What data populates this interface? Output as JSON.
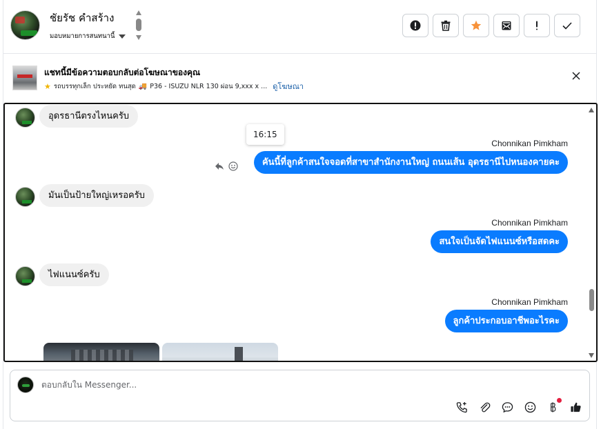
{
  "header": {
    "contact_name": "ชัยรัช คำสร้าง",
    "assign_label": "มอบหมายการสนทนานี้",
    "actions": [
      {
        "name": "report-button",
        "icon": "alert-circle-icon"
      },
      {
        "name": "delete-button",
        "icon": "trash-icon"
      },
      {
        "name": "star-button",
        "icon": "star-icon"
      },
      {
        "name": "mark-unread-button",
        "icon": "envelope-icon"
      },
      {
        "name": "spam-button",
        "icon": "exclamation-icon"
      },
      {
        "name": "done-button",
        "icon": "check-icon"
      }
    ],
    "star_color": "#f7923a"
  },
  "ad": {
    "title": "แชทนี้มีข้อความตอบกลับต่อโฆษณาของคุณ",
    "description": "รถบรรทุกเล็ก ประหยัด ทนสุด",
    "description2": "P36 - ISUZU NLR 130 ผ่อน 9,xxx x ...",
    "link": "ดูโฆษณา"
  },
  "conversation": {
    "tooltip_time": "16:15",
    "messages": [
      {
        "dir": "in",
        "text": "อุดรธานีตรงไหนครับ"
      },
      {
        "dir": "out",
        "sender": "Chonnikan Pimkham",
        "text": "คันนี้ที่ลูกค้าสนใจจอดที่สาขาสำนักงานใหญ่ ถนนเส้น อุดรธานีไปหนองคายคะ"
      },
      {
        "dir": "in",
        "text": "มันเป็นป้ายใหญ่เหรอครับ"
      },
      {
        "dir": "out",
        "sender": "Chonnikan Pimkham",
        "text": "สนใจเป็นจัดไฟแนนซ์หรือสดคะ"
      },
      {
        "dir": "in",
        "text": "ไฟแนนซ์ครับ"
      },
      {
        "dir": "out",
        "sender": "Chonnikan Pimkham",
        "text": "ลูกค้าประกอบอาชีพอะไรคะ"
      }
    ],
    "bubble_out_color": "#0a7cff",
    "bubble_in_color": "#f0f0f0"
  },
  "composer": {
    "placeholder": "ตอบกลับใน Messenger...",
    "tools": [
      "phone-add-icon",
      "paperclip-icon",
      "chat-bubble-icon",
      "emoji-icon",
      "baht-icon",
      "thumbs-up-icon"
    ]
  }
}
